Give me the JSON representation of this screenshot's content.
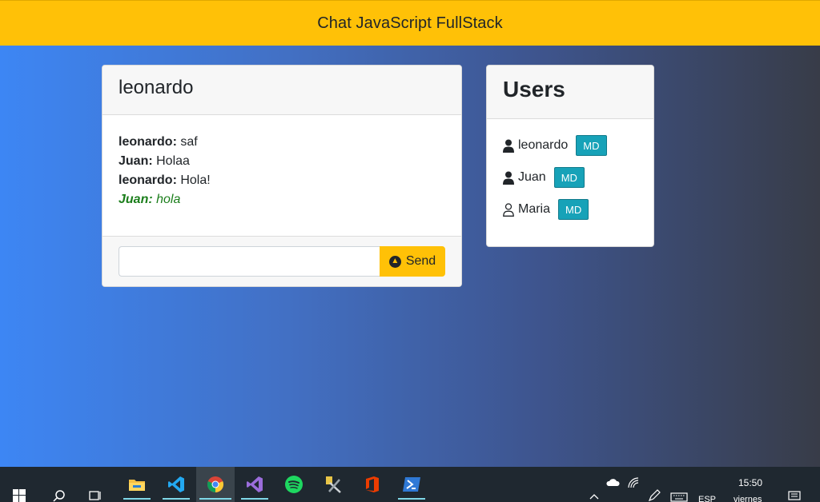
{
  "navbar": {
    "title": "Chat JavaScript FullStack"
  },
  "chat": {
    "username": "leonardo",
    "messages": [
      {
        "user": "leonardo:",
        "text": "saf",
        "whisper": false
      },
      {
        "user": "Juan:",
        "text": "Holaa",
        "whisper": false
      },
      {
        "user": "leonardo:",
        "text": "Hola!",
        "whisper": false
      },
      {
        "user": "Juan:",
        "text": "hola",
        "whisper": true
      }
    ],
    "input": {
      "value": "",
      "placeholder": ""
    },
    "send_label": "Send",
    "send_icon": "arrow-up-circle-icon"
  },
  "users": {
    "title": "Users",
    "list": [
      {
        "name": "leonardo",
        "icon": "user-solid-icon",
        "action": "MD"
      },
      {
        "name": "Juan",
        "icon": "user-solid-icon",
        "action": "MD"
      },
      {
        "name": "Maria",
        "icon": "user-outline-icon",
        "action": "MD"
      }
    ]
  },
  "taskbar": {
    "apps": [
      "windows-start-icon",
      "search-icon",
      "task-view-icon",
      "file-explorer-icon",
      "vscode-icon",
      "chrome-icon",
      "visual-studio-icon",
      "spotify-icon",
      "tools-icon",
      "office-icon",
      "powershell-icon"
    ],
    "clock_time": "15:50",
    "clock_day": "viernes",
    "language": "ESP"
  },
  "colors": {
    "accent": "#ffc107",
    "md_button": "#17a2b8",
    "whisper": "#1b7e1b"
  }
}
